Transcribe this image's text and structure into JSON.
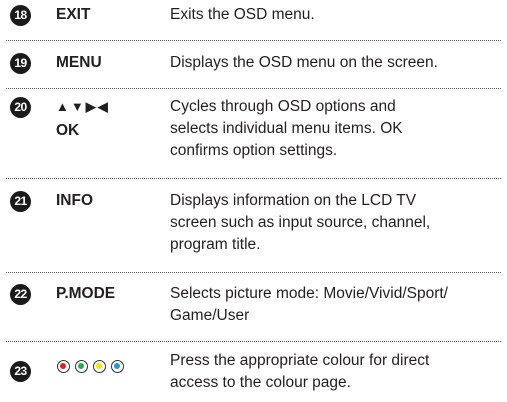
{
  "rows": [
    {
      "number": "18",
      "key": "EXIT",
      "desc": "Exits the OSD menu."
    },
    {
      "number": "19",
      "key": "MENU",
      "desc": "Displays the OSD menu on the screen."
    },
    {
      "number": "20",
      "key_line1": "▲▼▶◀",
      "key_line2": "OK",
      "desc_lines": [
        "Cycles through OSD options and",
        "selects individual menu items. OK",
        "confirms option settings."
      ]
    },
    {
      "number": "21",
      "key": "INFO",
      "desc_lines": [
        "Displays information on the LCD TV",
        "screen such as input source, channel,",
        "program title."
      ]
    },
    {
      "number": "22",
      "key": "P.MODE",
      "desc_lines": [
        "Selects picture mode: Movie/Vivid/Sport/",
        "Game/User"
      ]
    },
    {
      "number": "23",
      "desc_lines": [
        "Press the appropriate colour for direct",
        "access to the colour page."
      ]
    }
  ],
  "colour_buttons": [
    {
      "name": "red",
      "color": "#e31e24"
    },
    {
      "name": "green",
      "color": "#2aa84a"
    },
    {
      "name": "yellow",
      "color": "#f2e500"
    },
    {
      "name": "blue",
      "color": "#1e9ad6"
    }
  ]
}
